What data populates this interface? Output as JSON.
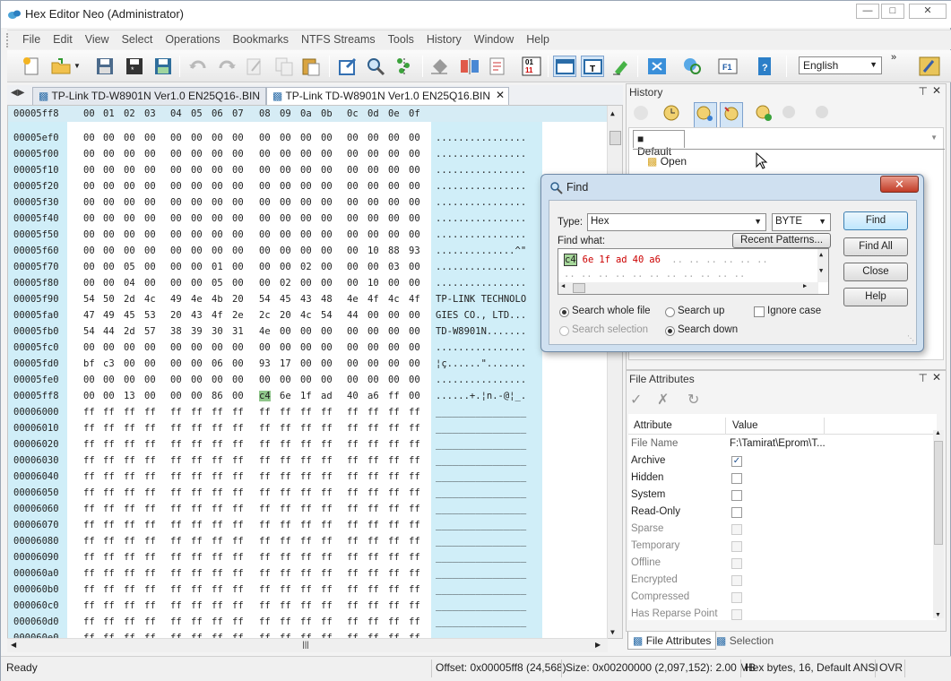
{
  "window": {
    "title": "Hex Editor Neo (Administrator)"
  },
  "menu": [
    "File",
    "Edit",
    "View",
    "Select",
    "Operations",
    "Bookmarks",
    "NTFS Streams",
    "Tools",
    "History",
    "Window",
    "Help"
  ],
  "toolbar": {
    "language": "English"
  },
  "tabs": [
    {
      "label": "TP-Link TD-W8901N Ver1.0  EN25Q16-.BIN",
      "active": false
    },
    {
      "label": "TP-Link TD-W8901N Ver1.0  EN25Q16.BIN",
      "active": true
    }
  ],
  "hex": {
    "header_offset": "00005ff8",
    "header_cols": [
      "00",
      "01",
      "02",
      "03",
      "04",
      "05",
      "06",
      "07",
      "08",
      "09",
      "0a",
      "0b",
      "0c",
      "0d",
      "0e",
      "0f"
    ],
    "rows": [
      {
        "off": "00005ef0",
        "b": [
          "00",
          "00",
          "00",
          "00",
          "00",
          "00",
          "00",
          "00",
          "00",
          "00",
          "00",
          "00",
          "00",
          "00",
          "00",
          "00"
        ],
        "t": "................"
      },
      {
        "off": "00005f00",
        "b": [
          "00",
          "00",
          "00",
          "00",
          "00",
          "00",
          "00",
          "00",
          "00",
          "00",
          "00",
          "00",
          "00",
          "00",
          "00",
          "00"
        ],
        "t": "................"
      },
      {
        "off": "00005f10",
        "b": [
          "00",
          "00",
          "00",
          "00",
          "00",
          "00",
          "00",
          "00",
          "00",
          "00",
          "00",
          "00",
          "00",
          "00",
          "00",
          "00"
        ],
        "t": "................"
      },
      {
        "off": "00005f20",
        "b": [
          "00",
          "00",
          "00",
          "00",
          "00",
          "00",
          "00",
          "00",
          "00",
          "00",
          "00",
          "00",
          "00",
          "00",
          "00",
          "00"
        ],
        "t": "................"
      },
      {
        "off": "00005f30",
        "b": [
          "00",
          "00",
          "00",
          "00",
          "00",
          "00",
          "00",
          "00",
          "00",
          "00",
          "00",
          "00",
          "00",
          "00",
          "00",
          "00"
        ],
        "t": "................"
      },
      {
        "off": "00005f40",
        "b": [
          "00",
          "00",
          "00",
          "00",
          "00",
          "00",
          "00",
          "00",
          "00",
          "00",
          "00",
          "00",
          "00",
          "00",
          "00",
          "00"
        ],
        "t": "................"
      },
      {
        "off": "00005f50",
        "b": [
          "00",
          "00",
          "00",
          "00",
          "00",
          "00",
          "00",
          "00",
          "00",
          "00",
          "00",
          "00",
          "00",
          "00",
          "00",
          "00"
        ],
        "t": "................"
      },
      {
        "off": "00005f60",
        "b": [
          "00",
          "00",
          "00",
          "00",
          "00",
          "00",
          "00",
          "00",
          "00",
          "00",
          "00",
          "00",
          "00",
          "10",
          "88",
          "93"
        ],
        "t": "..............^\""
      },
      {
        "off": "00005f70",
        "b": [
          "00",
          "00",
          "05",
          "00",
          "00",
          "00",
          "01",
          "00",
          "00",
          "00",
          "02",
          "00",
          "00",
          "00",
          "03",
          "00"
        ],
        "t": "................"
      },
      {
        "off": "00005f80",
        "b": [
          "00",
          "00",
          "04",
          "00",
          "00",
          "00",
          "05",
          "00",
          "00",
          "02",
          "00",
          "00",
          "00",
          "10",
          "00",
          "00"
        ],
        "t": "................"
      },
      {
        "off": "00005f90",
        "b": [
          "54",
          "50",
          "2d",
          "4c",
          "49",
          "4e",
          "4b",
          "20",
          "54",
          "45",
          "43",
          "48",
          "4e",
          "4f",
          "4c",
          "4f"
        ],
        "t": "TP-LINK TECHNOLO"
      },
      {
        "off": "00005fa0",
        "b": [
          "47",
          "49",
          "45",
          "53",
          "20",
          "43",
          "4f",
          "2e",
          "2c",
          "20",
          "4c",
          "54",
          "44",
          "00",
          "00",
          "00"
        ],
        "t": "GIES CO., LTD..."
      },
      {
        "off": "00005fb0",
        "b": [
          "54",
          "44",
          "2d",
          "57",
          "38",
          "39",
          "30",
          "31",
          "4e",
          "00",
          "00",
          "00",
          "00",
          "00",
          "00",
          "00"
        ],
        "t": "TD-W8901N......."
      },
      {
        "off": "00005fc0",
        "b": [
          "00",
          "00",
          "00",
          "00",
          "00",
          "00",
          "00",
          "00",
          "00",
          "00",
          "00",
          "00",
          "00",
          "00",
          "00",
          "00"
        ],
        "t": "................"
      },
      {
        "off": "00005fd0",
        "b": [
          "bf",
          "c3",
          "00",
          "00",
          "00",
          "00",
          "06",
          "00",
          "93",
          "17",
          "00",
          "00",
          "00",
          "00",
          "00",
          "00"
        ],
        "t": "¦ç......\"......."
      },
      {
        "off": "00005fe0",
        "b": [
          "00",
          "00",
          "00",
          "00",
          "00",
          "00",
          "00",
          "00",
          "00",
          "00",
          "00",
          "00",
          "00",
          "00",
          "00",
          "00"
        ],
        "t": "................"
      },
      {
        "off": "00005ff8",
        "b": [
          "00",
          "00",
          "13",
          "00",
          "00",
          "00",
          "86",
          "00",
          "c4",
          "6e",
          "1f",
          "ad",
          "40",
          "a6",
          "ff",
          "00"
        ],
        "t": "......+.¦n.-@¦_."
      },
      {
        "off": "00006000",
        "b": [
          "ff",
          "ff",
          "ff",
          "ff",
          "ff",
          "ff",
          "ff",
          "ff",
          "ff",
          "ff",
          "ff",
          "ff",
          "ff",
          "ff",
          "ff",
          "ff"
        ],
        "t": "________________"
      },
      {
        "off": "00006010",
        "b": [
          "ff",
          "ff",
          "ff",
          "ff",
          "ff",
          "ff",
          "ff",
          "ff",
          "ff",
          "ff",
          "ff",
          "ff",
          "ff",
          "ff",
          "ff",
          "ff"
        ],
        "t": "________________"
      },
      {
        "off": "00006020",
        "b": [
          "ff",
          "ff",
          "ff",
          "ff",
          "ff",
          "ff",
          "ff",
          "ff",
          "ff",
          "ff",
          "ff",
          "ff",
          "ff",
          "ff",
          "ff",
          "ff"
        ],
        "t": "________________"
      },
      {
        "off": "00006030",
        "b": [
          "ff",
          "ff",
          "ff",
          "ff",
          "ff",
          "ff",
          "ff",
          "ff",
          "ff",
          "ff",
          "ff",
          "ff",
          "ff",
          "ff",
          "ff",
          "ff"
        ],
        "t": "________________"
      },
      {
        "off": "00006040",
        "b": [
          "ff",
          "ff",
          "ff",
          "ff",
          "ff",
          "ff",
          "ff",
          "ff",
          "ff",
          "ff",
          "ff",
          "ff",
          "ff",
          "ff",
          "ff",
          "ff"
        ],
        "t": "________________"
      },
      {
        "off": "00006050",
        "b": [
          "ff",
          "ff",
          "ff",
          "ff",
          "ff",
          "ff",
          "ff",
          "ff",
          "ff",
          "ff",
          "ff",
          "ff",
          "ff",
          "ff",
          "ff",
          "ff"
        ],
        "t": "________________"
      },
      {
        "off": "00006060",
        "b": [
          "ff",
          "ff",
          "ff",
          "ff",
          "ff",
          "ff",
          "ff",
          "ff",
          "ff",
          "ff",
          "ff",
          "ff",
          "ff",
          "ff",
          "ff",
          "ff"
        ],
        "t": "________________"
      },
      {
        "off": "00006070",
        "b": [
          "ff",
          "ff",
          "ff",
          "ff",
          "ff",
          "ff",
          "ff",
          "ff",
          "ff",
          "ff",
          "ff",
          "ff",
          "ff",
          "ff",
          "ff",
          "ff"
        ],
        "t": "________________"
      },
      {
        "off": "00006080",
        "b": [
          "ff",
          "ff",
          "ff",
          "ff",
          "ff",
          "ff",
          "ff",
          "ff",
          "ff",
          "ff",
          "ff",
          "ff",
          "ff",
          "ff",
          "ff",
          "ff"
        ],
        "t": "________________"
      },
      {
        "off": "00006090",
        "b": [
          "ff",
          "ff",
          "ff",
          "ff",
          "ff",
          "ff",
          "ff",
          "ff",
          "ff",
          "ff",
          "ff",
          "ff",
          "ff",
          "ff",
          "ff",
          "ff"
        ],
        "t": "________________"
      },
      {
        "off": "000060a0",
        "b": [
          "ff",
          "ff",
          "ff",
          "ff",
          "ff",
          "ff",
          "ff",
          "ff",
          "ff",
          "ff",
          "ff",
          "ff",
          "ff",
          "ff",
          "ff",
          "ff"
        ],
        "t": "________________"
      },
      {
        "off": "000060b0",
        "b": [
          "ff",
          "ff",
          "ff",
          "ff",
          "ff",
          "ff",
          "ff",
          "ff",
          "ff",
          "ff",
          "ff",
          "ff",
          "ff",
          "ff",
          "ff",
          "ff"
        ],
        "t": "________________"
      },
      {
        "off": "000060c0",
        "b": [
          "ff",
          "ff",
          "ff",
          "ff",
          "ff",
          "ff",
          "ff",
          "ff",
          "ff",
          "ff",
          "ff",
          "ff",
          "ff",
          "ff",
          "ff",
          "ff"
        ],
        "t": "________________"
      },
      {
        "off": "000060d0",
        "b": [
          "ff",
          "ff",
          "ff",
          "ff",
          "ff",
          "ff",
          "ff",
          "ff",
          "ff",
          "ff",
          "ff",
          "ff",
          "ff",
          "ff",
          "ff",
          "ff"
        ],
        "t": "________________"
      },
      {
        "off": "000060e0",
        "b": [
          "ff",
          "ff",
          "ff",
          "ff",
          "ff",
          "ff",
          "ff",
          "ff",
          "ff",
          "ff",
          "ff",
          "ff",
          "ff",
          "ff",
          "ff",
          "ff"
        ],
        "t": "________________"
      }
    ]
  },
  "history": {
    "title": "History",
    "tab": "Default",
    "items": [
      "Open"
    ]
  },
  "find": {
    "title": "Find",
    "type_label": "Type:",
    "type_value": "Hex",
    "type_size": "BYTE",
    "find_what_label": "Find what:",
    "recent_patterns": "Recent Patterns...",
    "pattern": [
      "c4",
      "6e",
      "1f",
      "ad",
      "40",
      "a6"
    ],
    "buttons": {
      "find": "Find",
      "find_all": "Find All",
      "close": "Close",
      "help": "Help"
    },
    "options": {
      "search_whole_file": "Search whole file",
      "search_selection": "Search selection",
      "search_up": "Search up",
      "search_down": "Search down",
      "ignore_case": "Ignore case"
    }
  },
  "file_attributes": {
    "title": "File Attributes",
    "col_attribute": "Attribute",
    "col_value": "Value",
    "file_name_label": "File Name",
    "file_name_value": "F:\\Tamirat\\Eprom\\T...",
    "attrs": [
      {
        "name": "Archive",
        "checked": true,
        "enabled": true
      },
      {
        "name": "Hidden",
        "checked": false,
        "enabled": true
      },
      {
        "name": "System",
        "checked": false,
        "enabled": true
      },
      {
        "name": "Read-Only",
        "checked": false,
        "enabled": true
      },
      {
        "name": "Sparse",
        "checked": false,
        "enabled": false
      },
      {
        "name": "Temporary",
        "checked": false,
        "enabled": false
      },
      {
        "name": "Offline",
        "checked": false,
        "enabled": false
      },
      {
        "name": "Encrypted",
        "checked": false,
        "enabled": false
      },
      {
        "name": "Compressed",
        "checked": false,
        "enabled": false
      },
      {
        "name": "Has Reparse Point",
        "checked": false,
        "enabled": false
      }
    ]
  },
  "panel_tabs": {
    "file_attributes": "File Attributes",
    "selection": "Selection"
  },
  "status": {
    "ready": "Ready",
    "offset": "Offset: 0x00005ff8 (24,568)",
    "size": "Size: 0x00200000 (2,097,152): 2.00 MB",
    "mode": "Hex bytes, 16, Default ANSI",
    "ovr": "OVR"
  }
}
